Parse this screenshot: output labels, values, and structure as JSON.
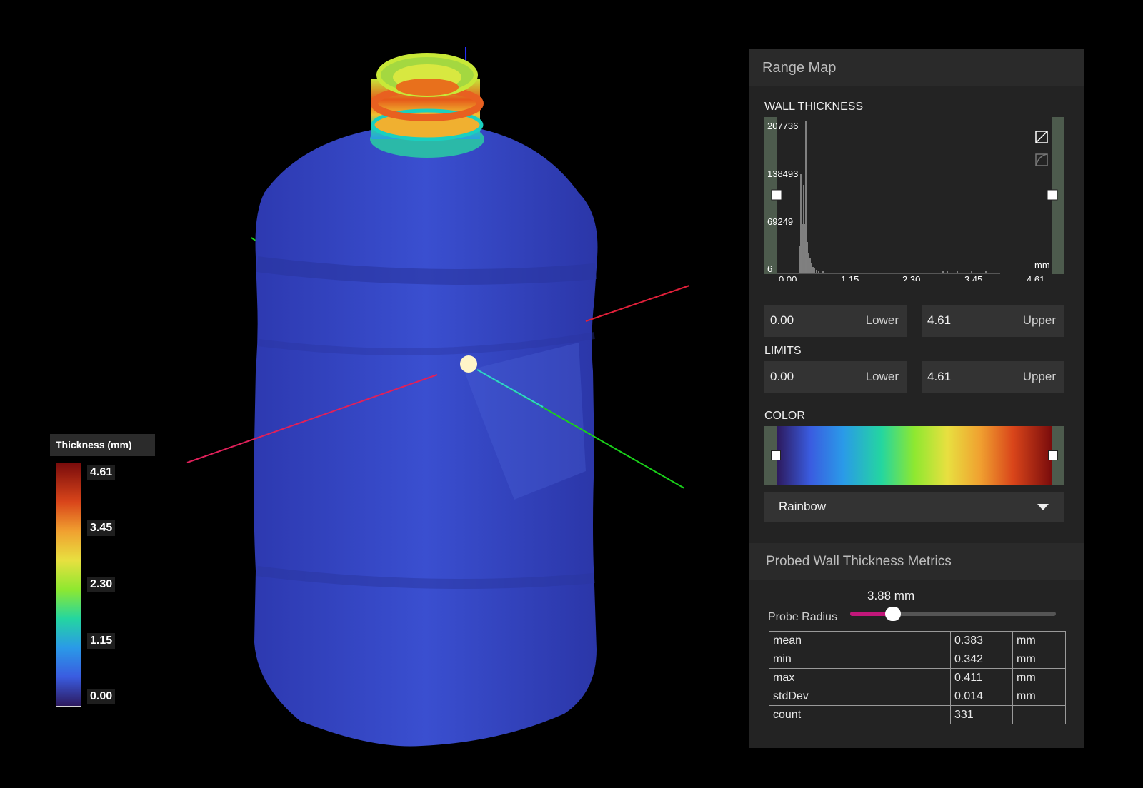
{
  "legend": {
    "title": "Thickness (mm)",
    "ticks": [
      "4.61",
      "3.45",
      "2.30",
      "1.15",
      "0.00"
    ]
  },
  "range_map": {
    "title": "Range Map",
    "wall_thickness_label": "WALL THICKNESS",
    "histogram": {
      "y_labels": [
        "207736",
        "138493",
        "69249",
        "6"
      ],
      "x_labels": [
        "0.00",
        "1.15",
        "2.30",
        "3.45",
        "4.61"
      ],
      "unit": "mm"
    },
    "range": {
      "lower_value": "0.00",
      "lower_label": "Lower",
      "upper_value": "4.61",
      "upper_label": "Upper"
    },
    "limits_label": "LIMITS",
    "limits": {
      "lower_value": "0.00",
      "lower_label": "Lower",
      "upper_value": "4.61",
      "upper_label": "Upper"
    },
    "color_label": "COLOR",
    "colormap": "Rainbow"
  },
  "probe": {
    "title": "Probed Wall Thickness Metrics",
    "radius_value": "3.88 mm",
    "radius_label": "Probe Radius",
    "radius_fraction": 0.21,
    "metrics": [
      {
        "name": "mean",
        "value": "0.383",
        "unit": "mm"
      },
      {
        "name": "min",
        "value": "0.342",
        "unit": "mm"
      },
      {
        "name": "max",
        "value": "0.411",
        "unit": "mm"
      },
      {
        "name": "stdDev",
        "value": "0.014",
        "unit": "mm"
      },
      {
        "name": "count",
        "value": "331",
        "unit": ""
      }
    ]
  },
  "colors": {
    "model": "#3848c8",
    "accent": "#c2177a"
  }
}
